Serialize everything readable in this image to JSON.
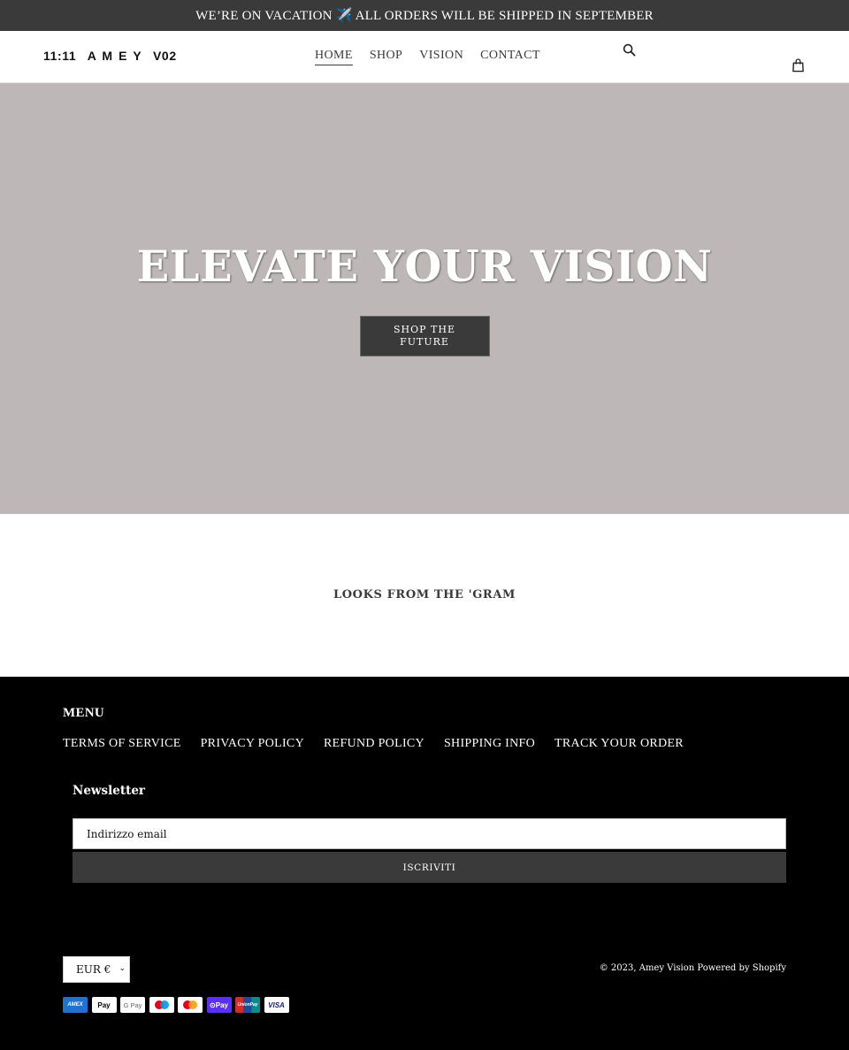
{
  "announcement": {
    "text": "WE’RE ON VACATION ✈️ ALL ORDERS WILL BE SHIPPED IN SEPTEMBER"
  },
  "header": {
    "logo": "11:11  A M E Y  V02",
    "nav": [
      {
        "label": "HOME",
        "active": true
      },
      {
        "label": "SHOP",
        "active": false
      },
      {
        "label": "VISION",
        "active": false
      },
      {
        "label": "CONTACT",
        "active": false
      }
    ],
    "icons": {
      "search": "search-icon",
      "cart": "cart-icon"
    }
  },
  "hero": {
    "title": "ELEVATE YOUR VISION",
    "button_label": "SHOP THE FUTURE",
    "background_color": "#bdb7b7"
  },
  "instagram": {
    "title": "LOOKS FROM THE 'GRAM"
  },
  "footer": {
    "menu_title": "MENU",
    "links": [
      "TERMS OF SERVICE",
      "PRIVACY POLICY",
      "REFUND POLICY",
      "SHIPPING INFO",
      "TRACK YOUR ORDER"
    ],
    "newsletter": {
      "title": "Newsletter",
      "email_placeholder": "Indirizzo email",
      "email_value": "",
      "subscribe_label": "ISCRIVITI"
    },
    "currency": {
      "selected": "EUR €"
    },
    "payment_methods": [
      {
        "name": "American Express",
        "label": "AMEX"
      },
      {
        "name": "Apple Pay",
        "label": " Pay"
      },
      {
        "name": "Google Pay",
        "label": "G Pay"
      },
      {
        "name": "Maestro",
        "label": ""
      },
      {
        "name": "Mastercard",
        "label": ""
      },
      {
        "name": "Shop Pay",
        "label": "⊙Pay"
      },
      {
        "name": "UnionPay",
        "label": "UnionPay"
      },
      {
        "name": "Visa",
        "label": "VISA"
      }
    ],
    "copyright_prefix": "© 2023,",
    "store_name": "Amey Vision",
    "powered_by": "Powered by Shopify"
  },
  "colors": {
    "announcement_bg": "#3a3a3a",
    "button_bg": "#3a3a3a",
    "footer_bg": "#000000",
    "text": "#3a3a3a"
  }
}
